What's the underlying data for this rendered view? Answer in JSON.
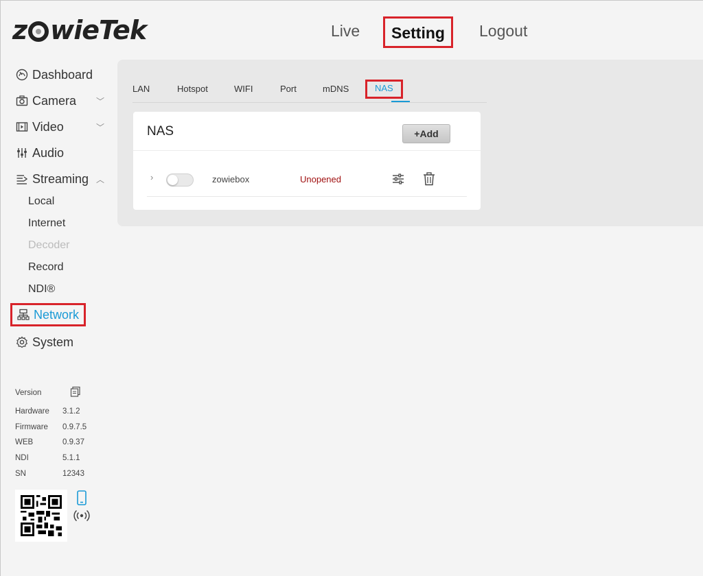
{
  "logo": {
    "text_left": "z",
    "text_right": "wieTek"
  },
  "topnav": {
    "live": "Live",
    "setting": "Setting",
    "logout": "Logout"
  },
  "sidebar": {
    "dashboard": "Dashboard",
    "camera": "Camera",
    "video": "Video",
    "audio": "Audio",
    "streaming": "Streaming",
    "streaming_sub": [
      "Local",
      "Internet",
      "Decoder",
      "Record",
      "NDI®"
    ],
    "network": "Network",
    "system": "System"
  },
  "version": {
    "title": "Version",
    "rows": [
      {
        "k": "Hardware",
        "v": "3.1.2"
      },
      {
        "k": "Firmware",
        "v": "0.9.7.5"
      },
      {
        "k": "WEB",
        "v": "0.9.37"
      },
      {
        "k": "NDI",
        "v": "5.1.1"
      },
      {
        "k": "SN",
        "v": "12343"
      }
    ]
  },
  "tabs": [
    "LAN",
    "Hotspot",
    "WIFI",
    "Port",
    "mDNS",
    "NAS"
  ],
  "card": {
    "title": "NAS",
    "add_label": "+Add",
    "rows": [
      {
        "name": "zowiebox",
        "status": "Unopened",
        "enabled": false
      }
    ]
  },
  "colors": {
    "accent": "#1a9ad6",
    "highlight": "#d8232a",
    "status_unopened": "#a01010"
  }
}
